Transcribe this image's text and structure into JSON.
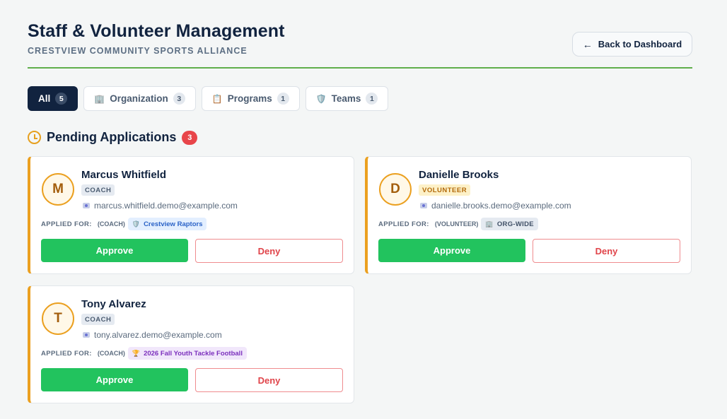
{
  "header": {
    "title": "Staff & Volunteer Management",
    "subtitle": "CRESTVIEW COMMUNITY SPORTS ALLIANCE",
    "back_label": "Back to Dashboard"
  },
  "tabs": [
    {
      "label": "All",
      "count": "5",
      "icon": ""
    },
    {
      "label": "Organization",
      "count": "3",
      "icon": "🏢"
    },
    {
      "label": "Programs",
      "count": "1",
      "icon": "📋"
    },
    {
      "label": "Teams",
      "count": "1",
      "icon": "🛡️"
    }
  ],
  "section": {
    "title": "Pending Applications",
    "count": "3"
  },
  "applied_label": "APPLIED FOR:",
  "approve_label": "Approve",
  "deny_label": "Deny",
  "applications": [
    {
      "initial": "M",
      "name": "Marcus Whitfield",
      "role": "COACH",
      "email": "marcus.whitfield.demo@example.com",
      "scope": "(COACH)",
      "target": "Crestview Raptors",
      "target_icon": "🛡️"
    },
    {
      "initial": "D",
      "name": "Danielle Brooks",
      "role": "VOLUNTEER",
      "email": "danielle.brooks.demo@example.com",
      "scope": "(VOLUNTEER)",
      "target": "ORG-WIDE",
      "target_icon": "🏢"
    },
    {
      "initial": "T",
      "name": "Tony Alvarez",
      "role": "COACH",
      "email": "tony.alvarez.demo@example.com",
      "scope": "(COACH)",
      "target": "2026 Fall Youth Tackle Football",
      "target_icon": "🏆"
    }
  ],
  "colors": {
    "accent_navy": "#11233f",
    "approve_green": "#22c35e",
    "deny_red": "#e0444a",
    "pending_orange": "#eba020",
    "divider_green": "#5fae4b"
  }
}
